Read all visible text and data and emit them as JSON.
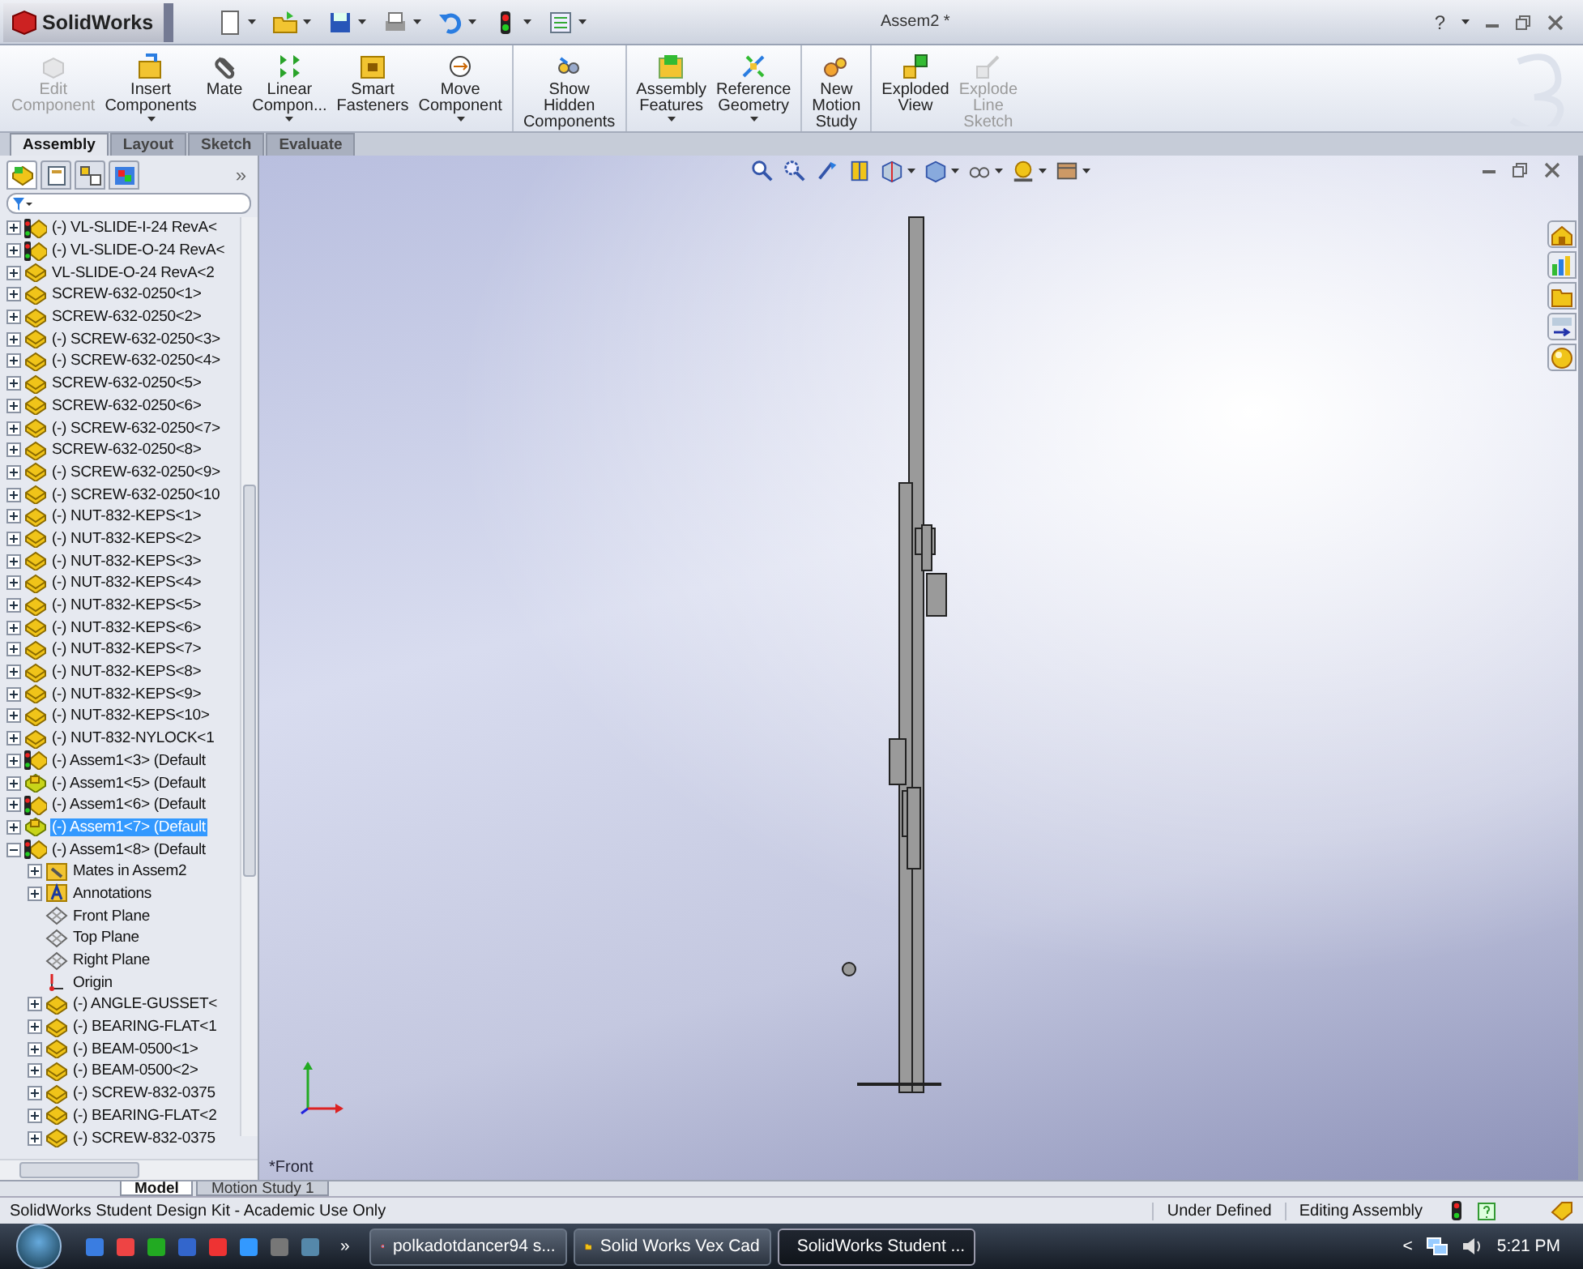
{
  "app": {
    "logo": "SolidWorks",
    "document_title": "Assem2 *",
    "help": "?"
  },
  "ribbon": [
    {
      "label": "Edit Component",
      "disabled": true,
      "dropdown": false,
      "separator_before": false
    },
    {
      "label": "Insert Components",
      "disabled": false,
      "dropdown": true,
      "separator_before": false
    },
    {
      "label": "Mate",
      "disabled": false,
      "dropdown": false,
      "separator_before": false
    },
    {
      "label": "Linear Compon...",
      "disabled": false,
      "dropdown": true,
      "separator_before": false
    },
    {
      "label": "Smart Fasteners",
      "disabled": false,
      "dropdown": false,
      "separator_before": false
    },
    {
      "label": "Move Component",
      "disabled": false,
      "dropdown": true,
      "separator_before": false
    },
    {
      "label": "Show Hidden Components",
      "disabled": false,
      "dropdown": false,
      "separator_before": true
    },
    {
      "label": "Assembly Features",
      "disabled": false,
      "dropdown": true,
      "separator_before": true
    },
    {
      "label": "Reference Geometry",
      "disabled": false,
      "dropdown": true,
      "separator_before": false
    },
    {
      "label": "New Motion Study",
      "disabled": false,
      "dropdown": false,
      "separator_before": true
    },
    {
      "label": "Exploded View",
      "disabled": false,
      "dropdown": false,
      "separator_before": true
    },
    {
      "label": "Explode Line Sketch",
      "disabled": true,
      "dropdown": false,
      "separator_before": false
    }
  ],
  "tabs": [
    {
      "label": "Assembly",
      "selected": true
    },
    {
      "label": "Layout",
      "selected": false
    },
    {
      "label": "Sketch",
      "selected": false
    },
    {
      "label": "Evaluate",
      "selected": false
    }
  ],
  "panel_tabs": [
    {
      "selected": true
    },
    {
      "selected": false
    },
    {
      "selected": false
    },
    {
      "selected": false
    }
  ],
  "panel_more": "»",
  "tree": [
    {
      "label": "(-) VL-SLIDE-I-24 RevA<",
      "kind": "assembly-warning",
      "expanded": false,
      "selected": false
    },
    {
      "label": "(-) VL-SLIDE-O-24 RevA<",
      "kind": "assembly-warning",
      "expanded": false,
      "selected": false
    },
    {
      "label": "VL-SLIDE-O-24 RevA<2",
      "kind": "part",
      "expanded": false,
      "selected": false
    },
    {
      "label": "SCREW-632-0250<1>",
      "kind": "part",
      "expanded": false,
      "selected": false
    },
    {
      "label": "SCREW-632-0250<2>",
      "kind": "part",
      "expanded": false,
      "selected": false
    },
    {
      "label": "(-) SCREW-632-0250<3>",
      "kind": "part",
      "expanded": false,
      "selected": false
    },
    {
      "label": "(-) SCREW-632-0250<4>",
      "kind": "part",
      "expanded": false,
      "selected": false
    },
    {
      "label": "SCREW-632-0250<5>",
      "kind": "part",
      "expanded": false,
      "selected": false
    },
    {
      "label": "SCREW-632-0250<6>",
      "kind": "part",
      "expanded": false,
      "selected": false
    },
    {
      "label": "(-) SCREW-632-0250<7>",
      "kind": "part",
      "expanded": false,
      "selected": false
    },
    {
      "label": "SCREW-632-0250<8>",
      "kind": "part",
      "expanded": false,
      "selected": false
    },
    {
      "label": "(-) SCREW-632-0250<9>",
      "kind": "part",
      "expanded": false,
      "selected": false
    },
    {
      "label": "(-) SCREW-632-0250<10",
      "kind": "part",
      "expanded": false,
      "selected": false
    },
    {
      "label": "(-) NUT-832-KEPS<1>",
      "kind": "part",
      "expanded": false,
      "selected": false
    },
    {
      "label": "(-) NUT-832-KEPS<2>",
      "kind": "part",
      "expanded": false,
      "selected": false
    },
    {
      "label": "(-) NUT-832-KEPS<3>",
      "kind": "part",
      "expanded": false,
      "selected": false
    },
    {
      "label": "(-) NUT-832-KEPS<4>",
      "kind": "part",
      "expanded": false,
      "selected": false
    },
    {
      "label": "(-) NUT-832-KEPS<5>",
      "kind": "part",
      "expanded": false,
      "selected": false
    },
    {
      "label": "(-) NUT-832-KEPS<6>",
      "kind": "part",
      "expanded": false,
      "selected": false
    },
    {
      "label": "(-) NUT-832-KEPS<7>",
      "kind": "part",
      "expanded": false,
      "selected": false
    },
    {
      "label": "(-) NUT-832-KEPS<8>",
      "kind": "part",
      "expanded": false,
      "selected": false
    },
    {
      "label": "(-) NUT-832-KEPS<9>",
      "kind": "part",
      "expanded": false,
      "selected": false
    },
    {
      "label": "(-) NUT-832-KEPS<10>",
      "kind": "part",
      "expanded": false,
      "selected": false
    },
    {
      "label": "(-) NUT-832-NYLOCK<1",
      "kind": "part",
      "expanded": false,
      "selected": false
    },
    {
      "label": "(-) Assem1<3> (Default",
      "kind": "assembly-warning",
      "expanded": false,
      "selected": false
    },
    {
      "label": "(-) Assem1<5> (Default",
      "kind": "assembly",
      "expanded": false,
      "selected": false
    },
    {
      "label": "(-) Assem1<6> (Default",
      "kind": "assembly-warning",
      "expanded": false,
      "selected": false
    },
    {
      "label": "(-) Assem1<7> (Default",
      "kind": "assembly",
      "expanded": false,
      "selected": true
    },
    {
      "label": "(-) Assem1<8> (Default",
      "kind": "assembly-warning",
      "expanded": true,
      "selected": false,
      "children": [
        {
          "label": "Mates in Assem2",
          "kind": "mates",
          "expanded": false,
          "selected": false
        },
        {
          "label": "Annotations",
          "kind": "annotations",
          "expanded": false,
          "selected": false
        },
        {
          "label": "Front Plane",
          "kind": "plane",
          "selected": false
        },
        {
          "label": "Top Plane",
          "kind": "plane",
          "selected": false
        },
        {
          "label": "Right Plane",
          "kind": "plane",
          "selected": false
        },
        {
          "label": "Origin",
          "kind": "origin",
          "selected": false
        },
        {
          "label": "(-) ANGLE-GUSSET<",
          "kind": "part",
          "expanded": false,
          "selected": false
        },
        {
          "label": "(-) BEARING-FLAT<1",
          "kind": "part",
          "expanded": false,
          "selected": false
        },
        {
          "label": "(-) BEAM-0500<1>",
          "kind": "part",
          "expanded": false,
          "selected": false
        },
        {
          "label": "(-) BEAM-0500<2>",
          "kind": "part",
          "expanded": false,
          "selected": false
        },
        {
          "label": "(-) SCREW-832-0375",
          "kind": "part",
          "expanded": false,
          "selected": false
        },
        {
          "label": "(-) BEARING-FLAT<2",
          "kind": "part",
          "expanded": false,
          "selected": false
        },
        {
          "label": "(-) SCREW-832-0375",
          "kind": "part",
          "expanded": false,
          "selected": false
        }
      ]
    }
  ],
  "viewport": {
    "view_name": "*Front"
  },
  "bottom_tabs": [
    {
      "label": "Model",
      "selected": true
    },
    {
      "label": "Motion Study 1",
      "selected": false
    }
  ],
  "status_bar": {
    "message": "SolidWorks Student Design Kit - Academic Use Only",
    "state": "Under Defined",
    "mode": "Editing Assembly"
  },
  "taskbar": {
    "more": "»",
    "tasks": [
      {
        "label": "polkadotdancer94 s...",
        "selected": false
      },
      {
        "label": "Solid Works Vex Cad",
        "selected": false
      },
      {
        "label": "SolidWorks Student ...",
        "selected": true
      }
    ],
    "tray_expand": "<",
    "clock": "5:21 PM"
  }
}
